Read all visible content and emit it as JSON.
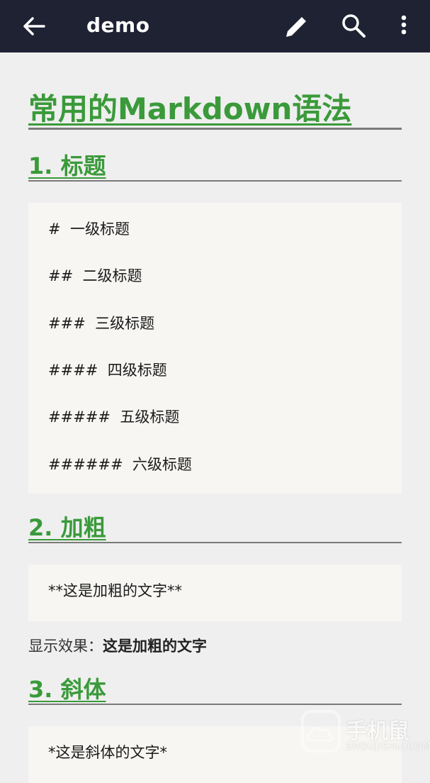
{
  "appbar": {
    "title": "demo",
    "icons": [
      "back-arrow-icon",
      "pencil-icon",
      "search-icon",
      "more-vertical-icon"
    ]
  },
  "document": {
    "title": "常用的Markdown语法",
    "sections": [
      {
        "heading": "1. 标题",
        "code_lines": [
          "#  一级标题",
          "##  二级标题",
          "###  三级标题",
          "####  四级标题",
          "#####  五级标题",
          "######  六级标题"
        ]
      },
      {
        "heading": "2. 加粗",
        "code_lines": [
          "**这是加粗的文字**"
        ],
        "result_label": "显示效果：",
        "result_value": "这是加粗的文字"
      },
      {
        "heading": "3. 斜体",
        "code_lines": [
          "*这是斜体的文字*"
        ]
      }
    ]
  },
  "watermark": {
    "text": "手机鼠",
    "subtext": "SHOUJISHU.COM"
  },
  "colors": {
    "appbar_bg": "#1e2233",
    "heading_green": "#3a9a3a",
    "page_bg": "#efefef",
    "code_bg": "#f7f6f3"
  }
}
